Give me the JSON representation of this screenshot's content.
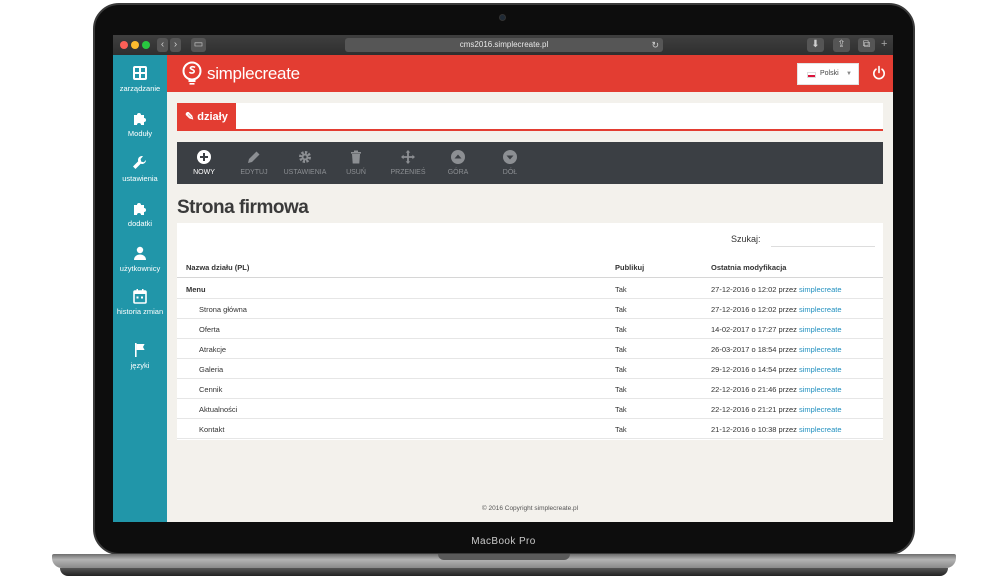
{
  "device": {
    "brand_label": "MacBook Pro"
  },
  "browser": {
    "url": "cms2016.simplecreate.pl"
  },
  "app": {
    "logo_text": "simplecreate",
    "accent_color": "#e33d32",
    "sidebar_color": "#2196a9"
  },
  "sidebar": {
    "items": [
      {
        "label": "zarządzanie",
        "icon": "grid-icon"
      },
      {
        "label": "Moduły",
        "icon": "puzzle-icon"
      },
      {
        "label": "ustawienia",
        "icon": "wrench-icon"
      },
      {
        "label": "dodatki",
        "icon": "puzzle-icon"
      },
      {
        "label": "użytkownicy",
        "icon": "user-icon"
      },
      {
        "label": "historia zmian",
        "icon": "calendar-icon"
      },
      {
        "label": "języki",
        "icon": "flag-icon"
      }
    ]
  },
  "header": {
    "language": "Polski"
  },
  "section": {
    "tab_label": "działy"
  },
  "toolbar": {
    "buttons": [
      {
        "label": "NOWY",
        "icon": "plus-circle-icon",
        "enabled": true
      },
      {
        "label": "EDYTUJ",
        "icon": "pencil-icon",
        "enabled": false
      },
      {
        "label": "USTAWIENIA",
        "icon": "gear-icon",
        "enabled": false
      },
      {
        "label": "USUŃ",
        "icon": "trash-icon",
        "enabled": false
      },
      {
        "label": "PRZENIEŚ",
        "icon": "move-icon",
        "enabled": false
      },
      {
        "label": "GÓRA",
        "icon": "arrow-up-circle-icon",
        "enabled": false
      },
      {
        "label": "DÓŁ",
        "icon": "arrow-down-circle-icon",
        "enabled": false
      }
    ]
  },
  "page": {
    "title": "Strona firmowa"
  },
  "table": {
    "search_label": "Szukaj:",
    "headers": [
      "Nazwa działu (PL)",
      "Publikuj",
      "Ostatnia modyfikacja"
    ],
    "rows": [
      {
        "name": "Menu",
        "publish": "Tak",
        "modified": "27-12-2016 o 12:02 przez",
        "author": "simplecreate"
      },
      {
        "name": "Strona główna",
        "publish": "Tak",
        "modified": "27-12-2016 o 12:02 przez",
        "author": "simplecreate"
      },
      {
        "name": "Oferta",
        "publish": "Tak",
        "modified": "14-02-2017 o 17:27 przez",
        "author": "simplecreate"
      },
      {
        "name": "Atrakcje",
        "publish": "Tak",
        "modified": "26-03-2017 o 18:54 przez",
        "author": "simplecreate"
      },
      {
        "name": "Galeria",
        "publish": "Tak",
        "modified": "29-12-2016 o 14:54 przez",
        "author": "simplecreate"
      },
      {
        "name": "Cennik",
        "publish": "Tak",
        "modified": "22-12-2016 o 21:46 przez",
        "author": "simplecreate"
      },
      {
        "name": "Aktualności",
        "publish": "Tak",
        "modified": "22-12-2016 o 21:21 przez",
        "author": "simplecreate"
      },
      {
        "name": "Kontakt",
        "publish": "Tak",
        "modified": "21-12-2016 o 10:38 przez",
        "author": "simplecreate"
      }
    ]
  },
  "footer": {
    "copyright": "© 2016 Copyright simplecreate.pl"
  }
}
